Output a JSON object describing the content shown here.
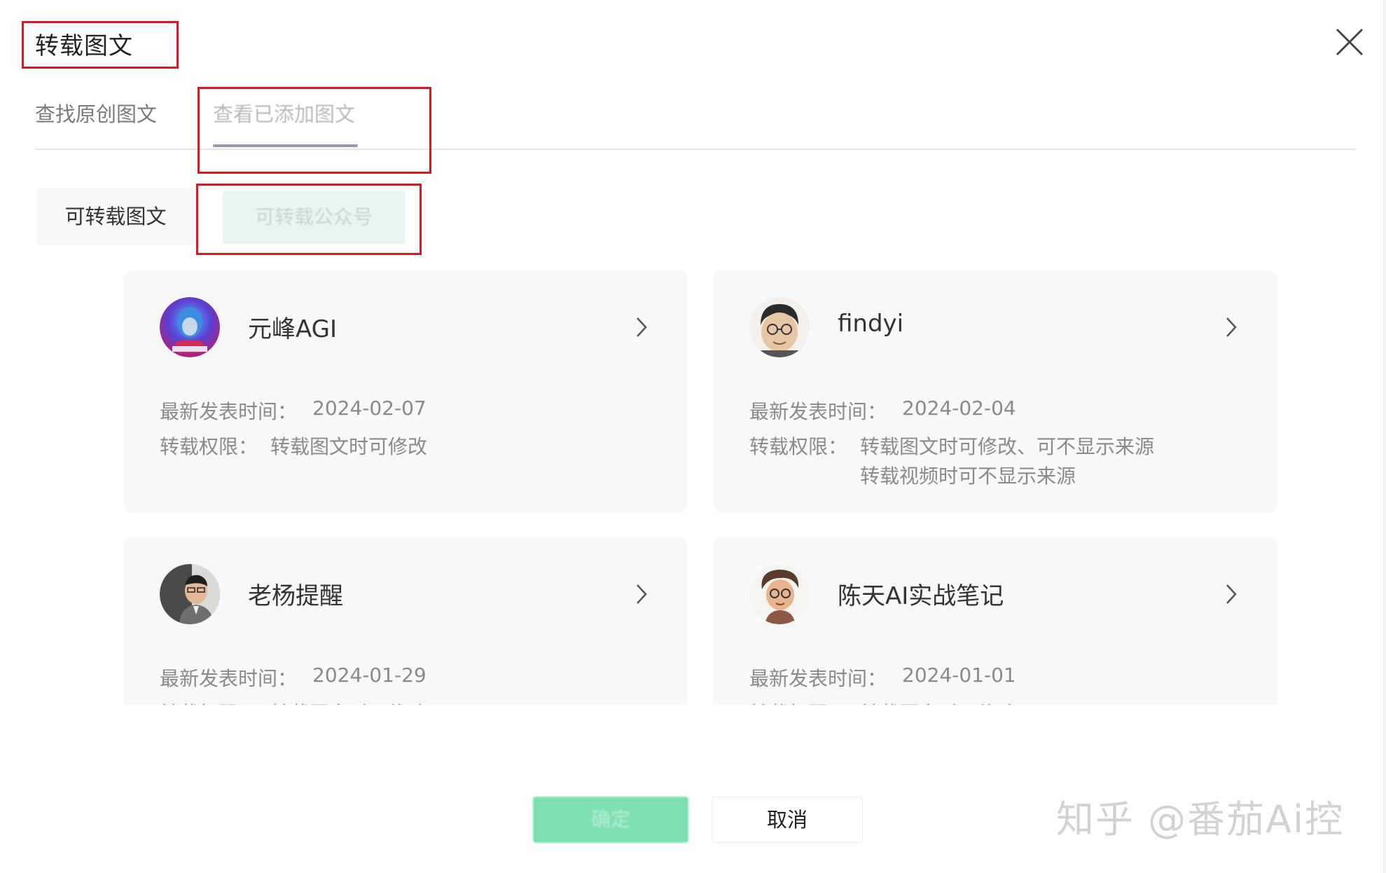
{
  "dialog": {
    "title": "转载图文",
    "close_icon": "close-icon"
  },
  "tabs": [
    {
      "label": "查找原创图文",
      "active": false
    },
    {
      "label": "查看已添加图文",
      "active": true
    }
  ],
  "segments": [
    {
      "label": "可转载图文",
      "selected": false
    },
    {
      "label": "可转载公众号",
      "selected": true
    }
  ],
  "accounts": [
    {
      "name": "元峰AGI",
      "latest_label": "最新发表时间：",
      "latest_date": "2024-02-07",
      "permission_label": "转载权限：",
      "permissions": [
        "转载图文时可修改"
      ]
    },
    {
      "name": "findyi",
      "latest_label": "最新发表时间：",
      "latest_date": "2024-02-04",
      "permission_label": "转载权限：",
      "permissions": [
        "转载图文时可修改、可不显示来源",
        "转载视频时可不显示来源"
      ]
    },
    {
      "name": "老杨提醒",
      "latest_label": "最新发表时间：",
      "latest_date": "2024-01-29",
      "permission_label": "转载权限：",
      "permissions": [
        "转载图文时可修改"
      ]
    },
    {
      "name": "陈天AI实战笔记",
      "latest_label": "最新发表时间：",
      "latest_date": "2024-01-01",
      "permission_label": "转载权限：",
      "permissions": [
        "转载图文时可修改"
      ]
    }
  ],
  "footer": {
    "confirm_label": "确定",
    "cancel_label": "取消"
  },
  "watermark": "知乎 @番茄Ai控",
  "colors": {
    "highlight_box": "#d71920",
    "primary_green": "#7ee0b2",
    "tab_underline": "#9a99b3"
  }
}
